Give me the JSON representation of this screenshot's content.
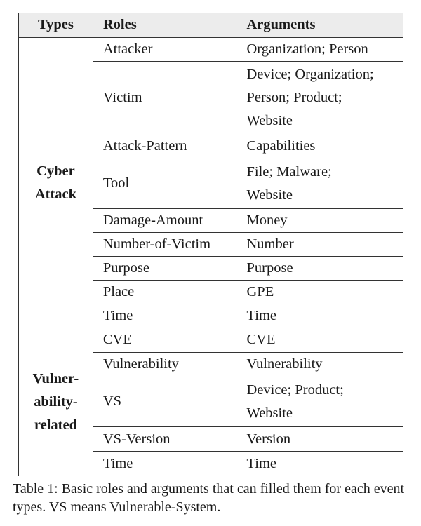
{
  "table": {
    "headers": [
      "Types",
      "Roles",
      "Arguments"
    ],
    "groups": [
      {
        "type_lines": [
          "Cyber",
          "Attack"
        ],
        "rows": [
          {
            "role": "Attacker",
            "argument_lines": [
              "Organization; Person"
            ]
          },
          {
            "role": "Victim",
            "argument_lines": [
              "Device; Organization;",
              "Person; Product;",
              "Website"
            ]
          },
          {
            "role": "Attack-Pattern",
            "argument_lines": [
              "Capabilities"
            ]
          },
          {
            "role": "Tool",
            "argument_lines": [
              "File; Malware;",
              "Website"
            ]
          },
          {
            "role": "Damage-Amount",
            "argument_lines": [
              "Money"
            ]
          },
          {
            "role": "Number-of-Victim",
            "argument_lines": [
              "Number"
            ]
          },
          {
            "role": "Purpose",
            "argument_lines": [
              "Purpose"
            ]
          },
          {
            "role": "Place",
            "argument_lines": [
              "GPE"
            ]
          },
          {
            "role": "Time",
            "argument_lines": [
              "Time"
            ]
          }
        ]
      },
      {
        "type_lines": [
          "Vulner-",
          "ability-",
          "related"
        ],
        "rows": [
          {
            "role": "CVE",
            "argument_lines": [
              "CVE"
            ]
          },
          {
            "role": "Vulnerability",
            "argument_lines": [
              "Vulnerability"
            ]
          },
          {
            "role": "VS",
            "argument_lines": [
              "Device; Product;",
              "Website"
            ]
          },
          {
            "role": "VS-Version",
            "argument_lines": [
              "Version"
            ]
          },
          {
            "role": "Time",
            "argument_lines": [
              "Time"
            ]
          }
        ]
      }
    ]
  },
  "caption": "Table 1: Basic roles and arguments that can filled them for each event types. VS means Vulnerable-System."
}
